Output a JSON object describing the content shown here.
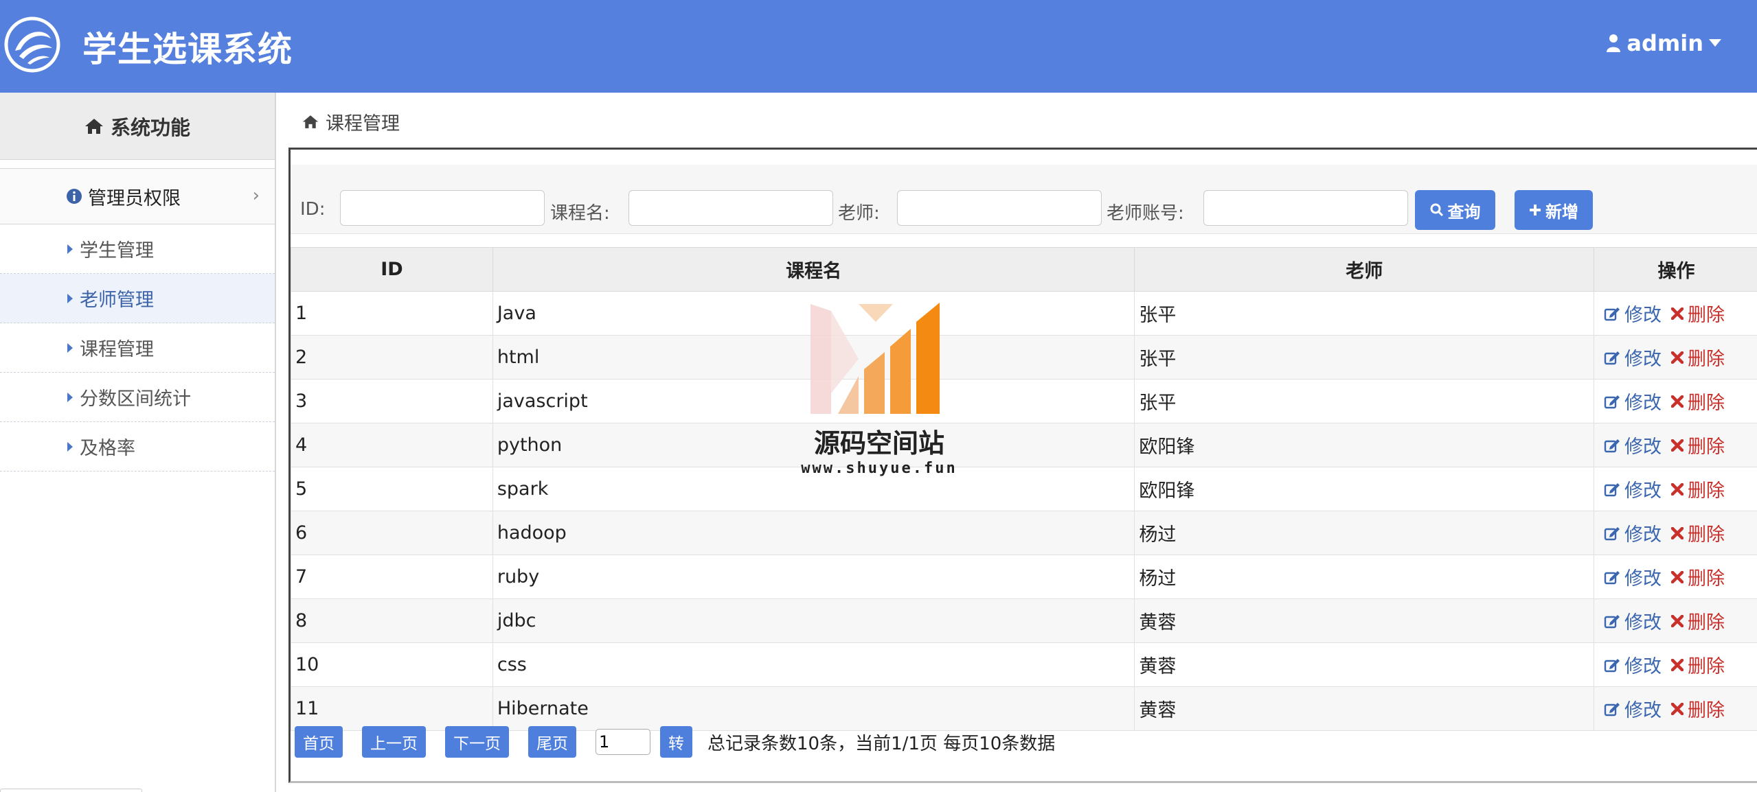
{
  "app": {
    "title": "学生选课系统",
    "user": "admin"
  },
  "sidebar": {
    "header": "系统功能",
    "group": "管理员权限",
    "items": [
      {
        "label": "学生管理"
      },
      {
        "label": "老师管理"
      },
      {
        "label": "课程管理"
      },
      {
        "label": "分数区间统计"
      },
      {
        "label": "及格率"
      }
    ]
  },
  "breadcrumb": "课程管理",
  "search": {
    "labels": [
      "ID:",
      "课程名:",
      "老师:",
      "老师账号:"
    ],
    "values": [
      "",
      "",
      "",
      ""
    ],
    "query_button": "查询",
    "add_button": "新增"
  },
  "table": {
    "columns": [
      "ID",
      "课程名",
      "老师",
      "操作"
    ],
    "rows": [
      {
        "id": "1",
        "name": "Java",
        "teacher": "张平"
      },
      {
        "id": "2",
        "name": "html",
        "teacher": "张平"
      },
      {
        "id": "3",
        "name": "javascript",
        "teacher": "张平"
      },
      {
        "id": "4",
        "name": "python",
        "teacher": "欧阳锋"
      },
      {
        "id": "5",
        "name": "spark",
        "teacher": "欧阳锋"
      },
      {
        "id": "6",
        "name": "hadoop",
        "teacher": "杨过"
      },
      {
        "id": "7",
        "name": "ruby",
        "teacher": "杨过"
      },
      {
        "id": "8",
        "name": "jdbc",
        "teacher": "黄蓉"
      },
      {
        "id": "10",
        "name": "css",
        "teacher": "黄蓉"
      },
      {
        "id": "11",
        "name": "Hibernate",
        "teacher": "黄蓉"
      }
    ],
    "edit_label": "修改",
    "delete_label": "删除"
  },
  "pager": {
    "first": "首页",
    "prev": "上一页",
    "next": "下一页",
    "last": "尾页",
    "page_value": "1",
    "go": "转",
    "info": "总记录条数10条，当前1/1页 每页10条数据"
  },
  "watermark": {
    "title": "源码空间站",
    "url": "www.shuyue.fun"
  },
  "colors": {
    "header": "#5580dd",
    "button": "#4f7fdc",
    "delete": "#c9302c",
    "edit": "#3a66b0"
  }
}
